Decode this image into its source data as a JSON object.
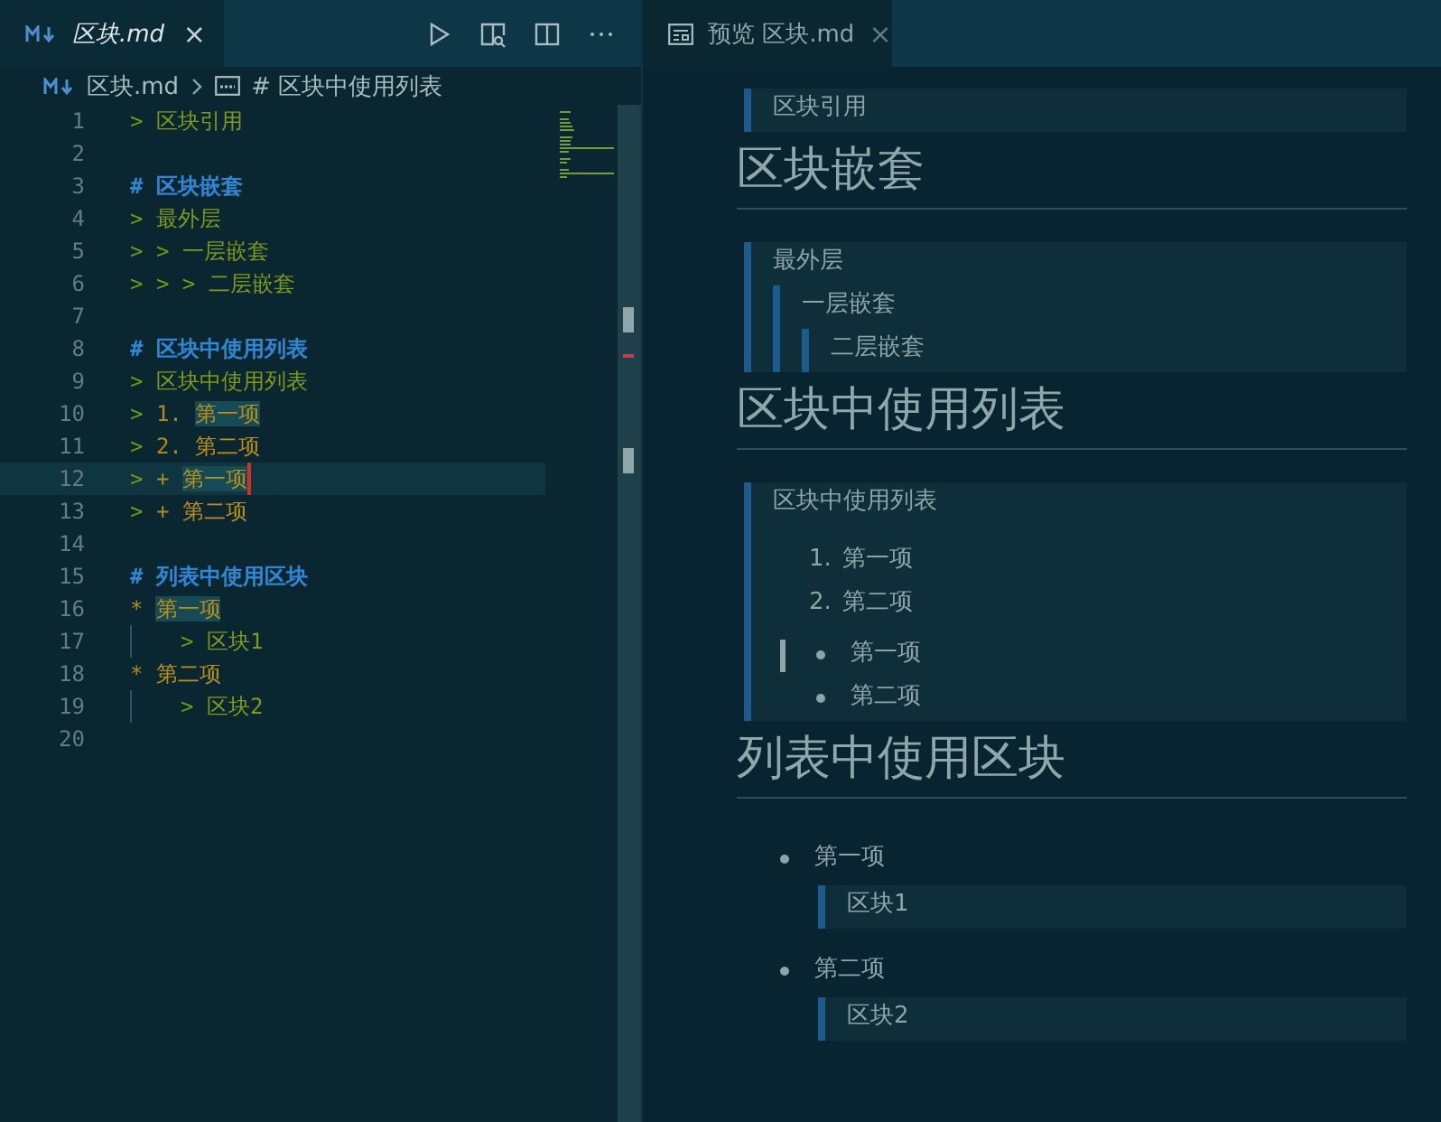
{
  "editor": {
    "tab": {
      "title": "区块.md",
      "close": "×",
      "selected": true
    },
    "breadcrumb": {
      "file": "区块.md",
      "symbol": "# 区块中使用列表"
    },
    "lines": [
      {
        "number": "1",
        "current": false,
        "indent_guide": false,
        "tokens": [
          {
            "text": "> ",
            "kind": "quote-mark",
            "highlighted": false
          },
          {
            "text": "区块引用",
            "kind": "quote",
            "highlighted": false
          }
        ]
      },
      {
        "number": "2",
        "current": false,
        "indent_guide": false
      },
      {
        "number": "3",
        "current": false,
        "indent_guide": false,
        "tokens": [
          {
            "text": "# 区块嵌套",
            "kind": "heading",
            "highlighted": false
          }
        ]
      },
      {
        "number": "4",
        "current": false,
        "indent_guide": false,
        "tokens": [
          {
            "text": "> ",
            "kind": "quote-mark",
            "highlighted": false
          },
          {
            "text": "最外层",
            "kind": "quote",
            "highlighted": false
          }
        ]
      },
      {
        "number": "5",
        "current": false,
        "indent_guide": false,
        "tokens": [
          {
            "text": "> > ",
            "kind": "quote-mark",
            "highlighted": false
          },
          {
            "text": "一层嵌套",
            "kind": "quote",
            "highlighted": false
          }
        ]
      },
      {
        "number": "6",
        "current": false,
        "indent_guide": false,
        "tokens": [
          {
            "text": "> > > ",
            "kind": "quote-mark",
            "highlighted": false
          },
          {
            "text": "二层嵌套",
            "kind": "quote",
            "highlighted": false
          }
        ]
      },
      {
        "number": "7",
        "current": false,
        "indent_guide": false
      },
      {
        "number": "8",
        "current": false,
        "indent_guide": false,
        "tokens": [
          {
            "text": "# 区块中使用列表",
            "kind": "heading",
            "highlighted": false
          }
        ]
      },
      {
        "number": "9",
        "current": false,
        "indent_guide": false,
        "tokens": [
          {
            "text": "> ",
            "kind": "quote-mark",
            "highlighted": false
          },
          {
            "text": "区块中使用列表",
            "kind": "quote",
            "highlighted": false
          }
        ]
      },
      {
        "number": "10",
        "current": false,
        "indent_guide": false,
        "tokens": [
          {
            "text": "> ",
            "kind": "quote-mark",
            "highlighted": false
          },
          {
            "text": "1. ",
            "kind": "list-mark",
            "highlighted": false
          },
          {
            "text": "第一项",
            "kind": "item",
            "highlighted": true
          }
        ]
      },
      {
        "number": "11",
        "current": false,
        "indent_guide": false,
        "tokens": [
          {
            "text": "> ",
            "kind": "quote-mark",
            "highlighted": false
          },
          {
            "text": "2. ",
            "kind": "list-mark",
            "highlighted": false
          },
          {
            "text": "第二项",
            "kind": "item",
            "highlighted": false
          }
        ]
      },
      {
        "number": "12",
        "current": true,
        "indent_guide": false,
        "tokens": [
          {
            "text": "> ",
            "kind": "quote-mark",
            "highlighted": false
          },
          {
            "text": "+ ",
            "kind": "list-mark",
            "highlighted": false
          },
          {
            "text": "第一项",
            "kind": "item",
            "highlighted": true
          }
        ]
      },
      {
        "number": "13",
        "current": false,
        "indent_guide": false,
        "tokens": [
          {
            "text": "> ",
            "kind": "quote-mark",
            "highlighted": false
          },
          {
            "text": "+ ",
            "kind": "list-mark",
            "highlighted": false
          },
          {
            "text": "第二项",
            "kind": "item",
            "highlighted": false
          }
        ]
      },
      {
        "number": "14",
        "current": false,
        "indent_guide": false
      },
      {
        "number": "15",
        "current": false,
        "indent_guide": false,
        "tokens": [
          {
            "text": "# 列表中使用区块",
            "kind": "heading",
            "highlighted": false
          }
        ]
      },
      {
        "number": "16",
        "current": false,
        "indent_guide": false,
        "tokens": [
          {
            "text": "* ",
            "kind": "bullet",
            "highlighted": false
          },
          {
            "text": "第一项",
            "kind": "item",
            "highlighted": true
          }
        ]
      },
      {
        "number": "17",
        "current": false,
        "indent_guide": true,
        "tokens": [
          {
            "text": "> ",
            "kind": "quote-mark",
            "highlighted": false
          },
          {
            "text": "区块1",
            "kind": "quote",
            "highlighted": false
          }
        ]
      },
      {
        "number": "18",
        "current": false,
        "indent_guide": false,
        "tokens": [
          {
            "text": "* ",
            "kind": "bullet",
            "highlighted": false
          },
          {
            "text": "第二项",
            "kind": "item",
            "highlighted": false
          }
        ]
      },
      {
        "number": "19",
        "current": false,
        "indent_guide": true,
        "tokens": [
          {
            "text": "> ",
            "kind": "quote-mark",
            "highlighted": false
          },
          {
            "text": "区块2",
            "kind": "quote",
            "highlighted": false
          }
        ]
      },
      {
        "number": "20",
        "current": false,
        "indent_guide": false
      }
    ]
  },
  "preview": {
    "tab": {
      "title": "预览 区块.md",
      "close": "×",
      "selected": false
    },
    "blocks": [
      {
        "kind": "quote",
        "text": "区块引用"
      },
      {
        "kind": "heading",
        "text": "区块嵌套"
      },
      {
        "kind": "quote",
        "text": "最外层",
        "children": [
          {
            "kind": "quote",
            "text": "一层嵌套",
            "children": [
              {
                "kind": "quote",
                "text": "二层嵌套"
              }
            ]
          }
        ]
      },
      {
        "kind": "heading",
        "text": "区块中使用列表"
      },
      {
        "kind": "quote",
        "text": "区块中使用列表",
        "children": [
          {
            "kind": "ordered-list",
            "items": [
              {
                "marker": "1.",
                "text": "第一项",
                "current": false
              },
              {
                "marker": "2.",
                "text": "第二项",
                "current": false
              }
            ]
          },
          {
            "kind": "bullet-list",
            "items": [
              {
                "text": "第一项",
                "current": true
              },
              {
                "text": "第二项",
                "current": false
              }
            ]
          }
        ]
      },
      {
        "kind": "heading",
        "text": "列表中使用区块"
      },
      {
        "kind": "bullet-list",
        "items": [
          {
            "text": "第一项",
            "current": false,
            "children": [
              {
                "kind": "quote",
                "text": "区块1"
              }
            ]
          },
          {
            "text": "第二项",
            "current": false,
            "children": [
              {
                "kind": "quote",
                "text": "区块2"
              }
            ]
          }
        ]
      }
    ]
  }
}
